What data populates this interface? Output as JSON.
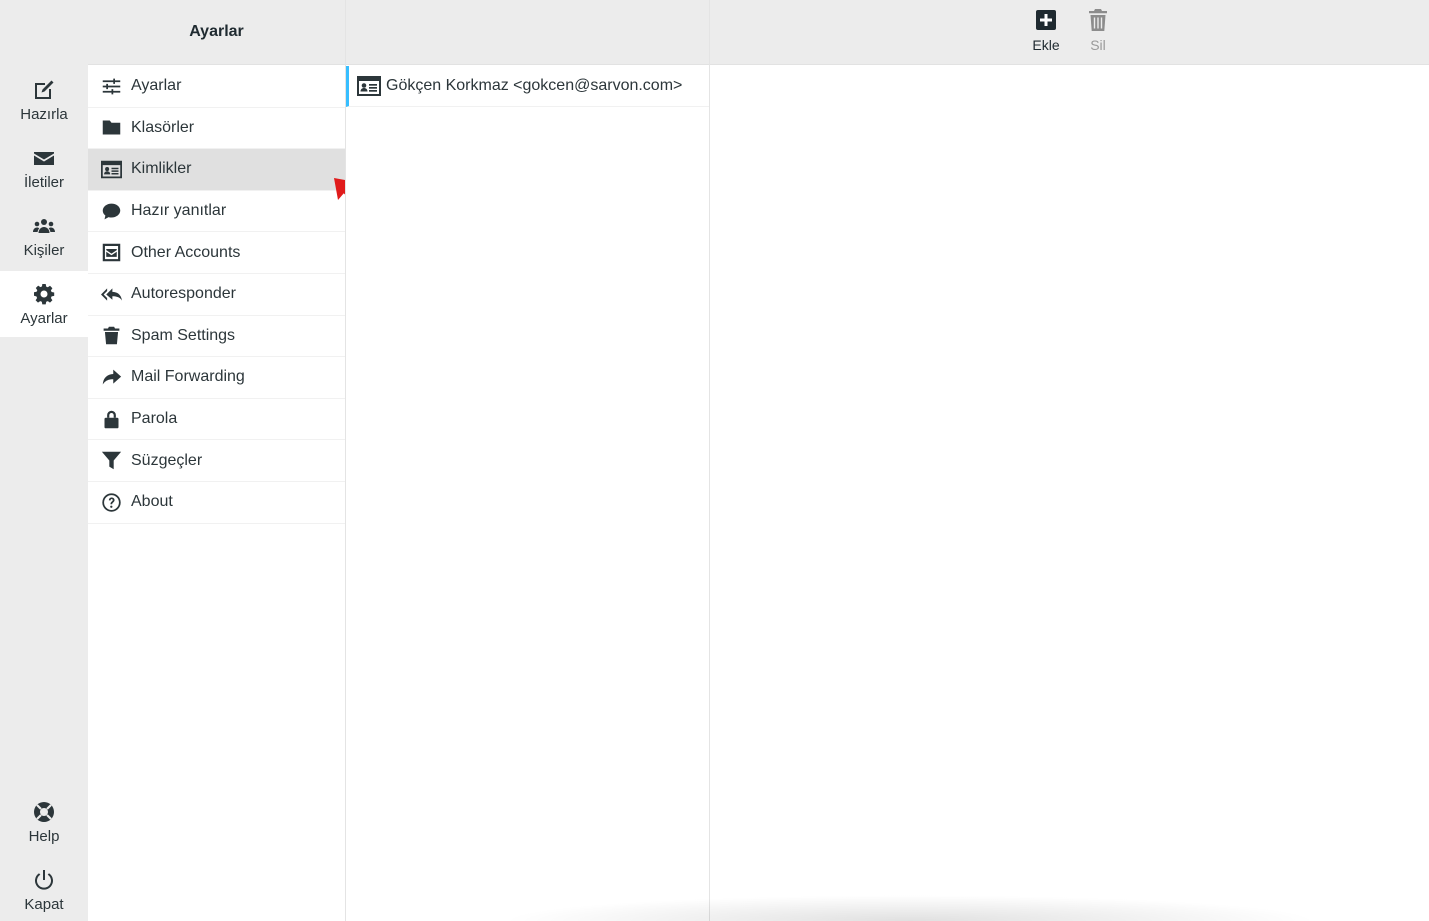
{
  "tasknav": {
    "items": [
      {
        "label": "Hazırla",
        "icon": "compose-icon"
      },
      {
        "label": "İletiler",
        "icon": "envelope-icon"
      },
      {
        "label": "Kişiler",
        "icon": "contacts-icon"
      },
      {
        "label": "Ayarlar",
        "icon": "gear-icon",
        "active": true
      }
    ],
    "bottom": [
      {
        "label": "Help",
        "icon": "lifebuoy-icon"
      },
      {
        "label": "Kapat",
        "icon": "power-icon"
      }
    ]
  },
  "settings_menu": {
    "header": "Ayarlar",
    "items": [
      {
        "label": "Ayarlar",
        "icon": "sliders-icon"
      },
      {
        "label": "Klasörler",
        "icon": "folder-icon"
      },
      {
        "label": "Kimlikler",
        "icon": "id-card-icon",
        "selected": true
      },
      {
        "label": "Hazır yanıtlar",
        "icon": "speech-bubble-icon"
      },
      {
        "label": "Other Accounts",
        "icon": "envelope-square-icon"
      },
      {
        "label": "Autoresponder",
        "icon": "reply-all-icon"
      },
      {
        "label": "Spam Settings",
        "icon": "trash-icon"
      },
      {
        "label": "Mail Forwarding",
        "icon": "share-arrow-icon"
      },
      {
        "label": "Parola",
        "icon": "lock-icon"
      },
      {
        "label": "Süzgeçler",
        "icon": "filter-icon"
      },
      {
        "label": "About",
        "icon": "question-circle-icon"
      }
    ]
  },
  "identities": {
    "items": [
      {
        "label": "Gökçen Korkmaz <gokcen@sarvon.com>",
        "icon": "id-card-icon"
      }
    ]
  },
  "toolbar": {
    "add_label": "Ekle",
    "delete_label": "Sil"
  },
  "colors": {
    "accent": "#37beff",
    "annotation_arrow": "#e01b1b",
    "selected_bg": "#e0e0e0",
    "header_bg": "#ececec"
  }
}
